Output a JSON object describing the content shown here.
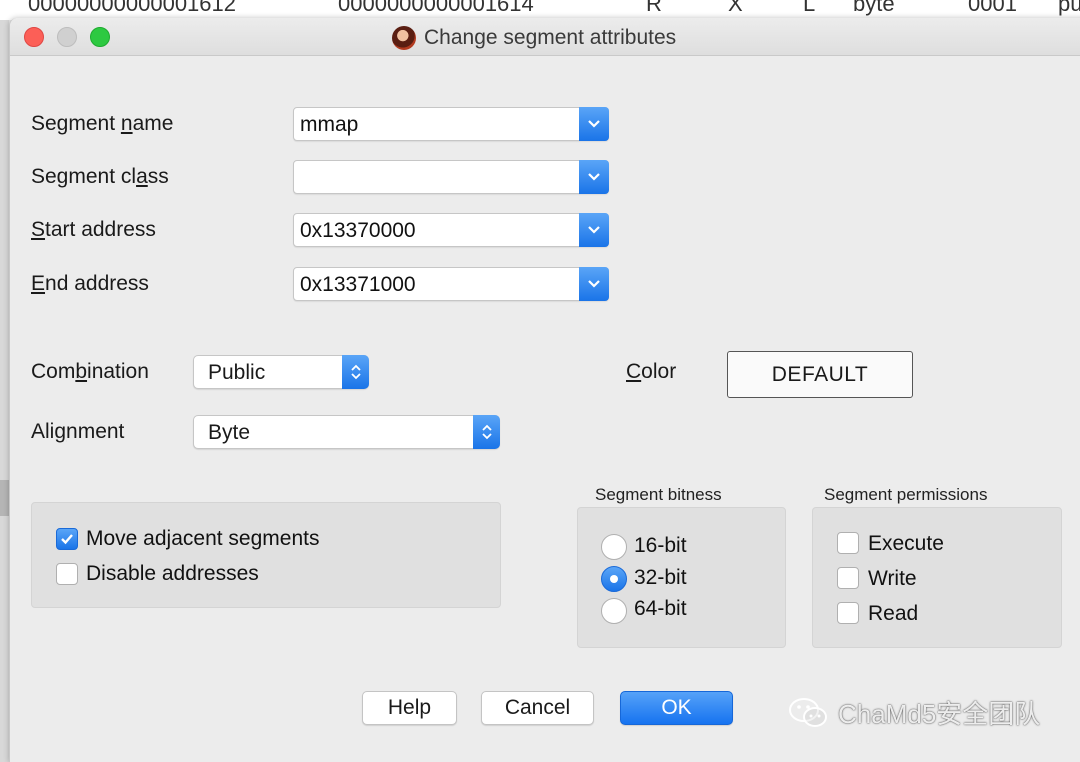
{
  "background_listing": [
    "00000000000001612",
    "0000000000001614",
    "R",
    ".",
    "X",
    ".",
    "L",
    "byte",
    "0001",
    "pu"
  ],
  "window": {
    "title": "Change segment attributes"
  },
  "fields": {
    "segment_name": {
      "label_pre": "Segment ",
      "label_u": "n",
      "label_post": "ame",
      "value": "mmap"
    },
    "segment_class": {
      "label_pre": "Segment cl",
      "label_u": "a",
      "label_post": "ss",
      "value": ""
    },
    "start_address": {
      "label_pre": "",
      "label_u": "S",
      "label_post": "tart address",
      "value": "0x13370000"
    },
    "end_address": {
      "label_pre": "",
      "label_u": "E",
      "label_post": "nd address",
      "value": "0x13371000"
    }
  },
  "combination": {
    "label_pre": "Com",
    "label_u": "b",
    "label_post": "ination",
    "value": "Public"
  },
  "alignment": {
    "label_pre": "Ali",
    "label_u": "g",
    "label_post": "nment",
    "value": "Byte"
  },
  "color": {
    "label_u": "C",
    "label_post": "olor",
    "value": "DEFAULT"
  },
  "move_options": [
    {
      "label": "Move adjacent segments",
      "checked": true
    },
    {
      "label": "Disable addresses",
      "checked": false
    }
  ],
  "bitness": {
    "title": "Segment bitness",
    "options": [
      {
        "label": "16-bit",
        "selected": false
      },
      {
        "label": "32-bit",
        "selected": true
      },
      {
        "label": "64-bit",
        "selected": false
      }
    ]
  },
  "permissions": {
    "title": "Segment permissions",
    "options": [
      {
        "label": "Execute",
        "checked": false
      },
      {
        "label": "Write",
        "checked": false
      },
      {
        "label": "Read",
        "checked": false
      }
    ]
  },
  "buttons": {
    "help": "Help",
    "cancel": "Cancel",
    "ok": "OK"
  },
  "watermark": "ChaMd5安全团队",
  "colors": {
    "accent": "#1a74e8",
    "close": "#fc5f57",
    "maximize": "#2dc941"
  },
  "icons": [
    "chevron-down-icon",
    "up-down-chevron-icon",
    "checkmark-icon",
    "ida-logo-icon",
    "wechat-icon"
  ]
}
